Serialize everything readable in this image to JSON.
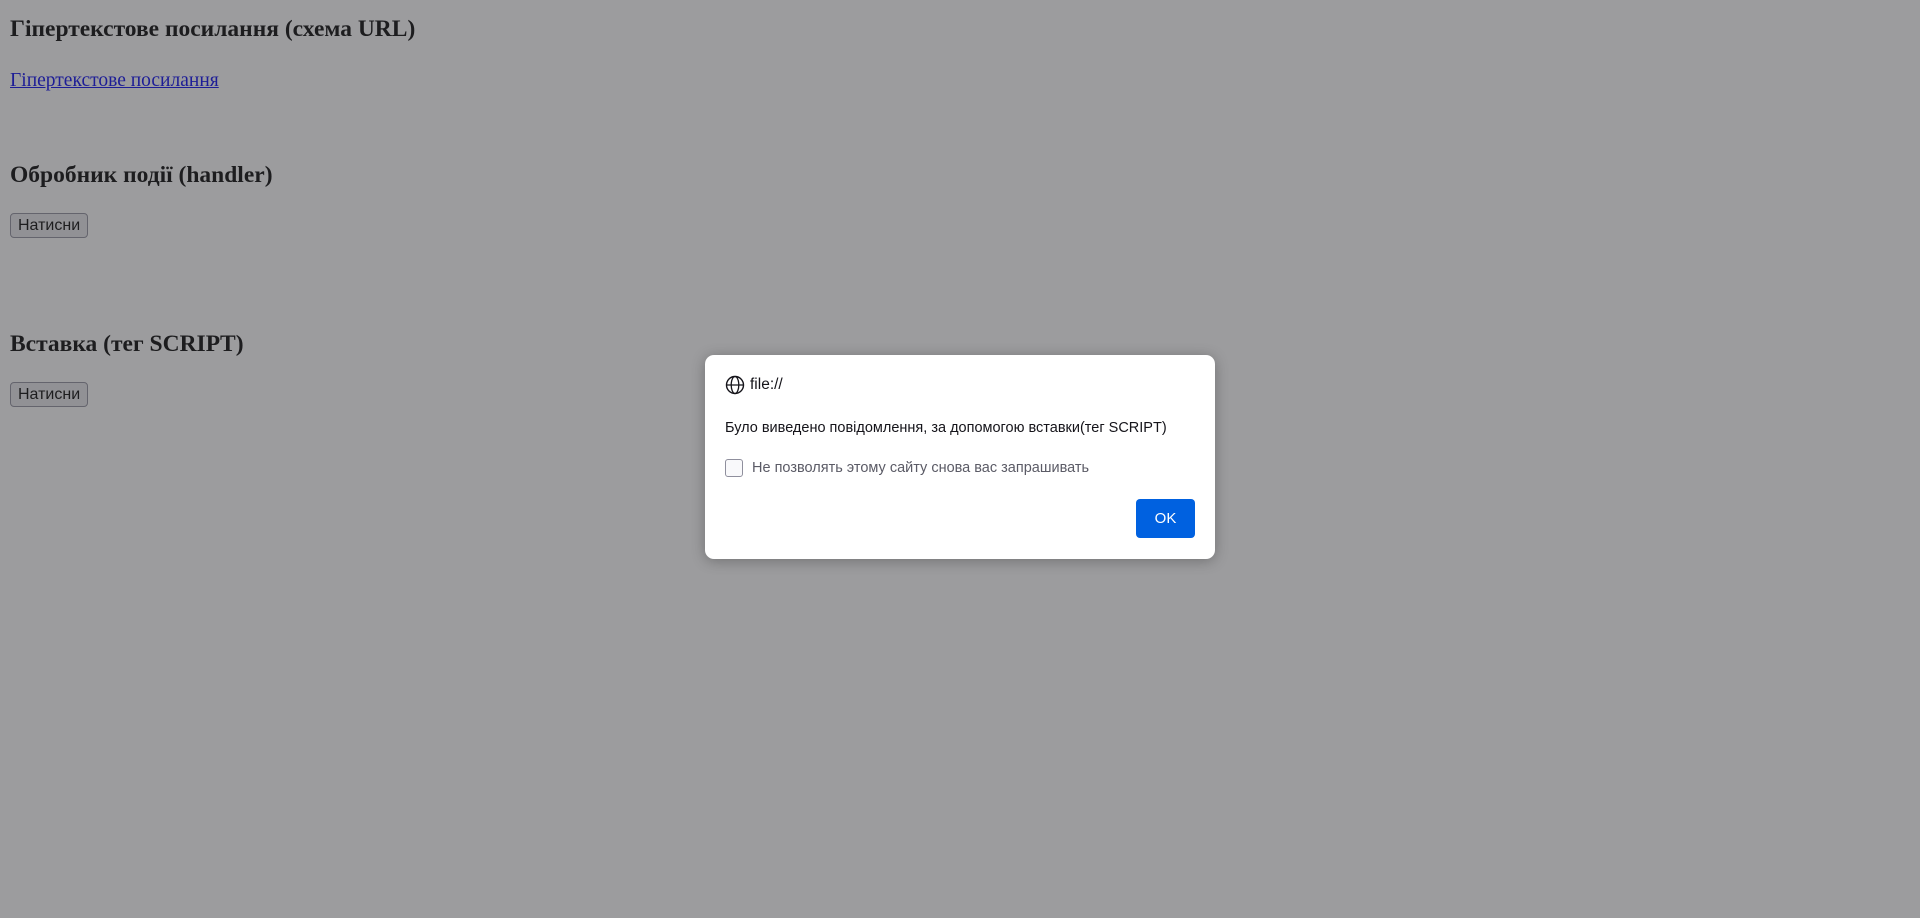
{
  "page": {
    "sections": [
      {
        "heading": "Гіпертекстове посилання (схема URL)",
        "link_text": "Гіпертекстове посилання"
      },
      {
        "heading": "Обробник події (handler)",
        "button_label": "Натисни"
      },
      {
        "heading": "Вставка (тег SCRIPT)",
        "button_label": "Натисни"
      }
    ]
  },
  "dialog": {
    "origin": "file://",
    "origin_icon": "globe-icon",
    "message": "Було виведено повідомлення, за допомогою вставки(тег SCRIPT)",
    "checkbox_label": "Не позволять этому сайту снова вас запрашивать",
    "checkbox_checked": false,
    "ok_label": "OK"
  },
  "colors": {
    "overlay": "#9a9a9c",
    "link": "#0000ee",
    "ok_button": "#0061e0"
  }
}
